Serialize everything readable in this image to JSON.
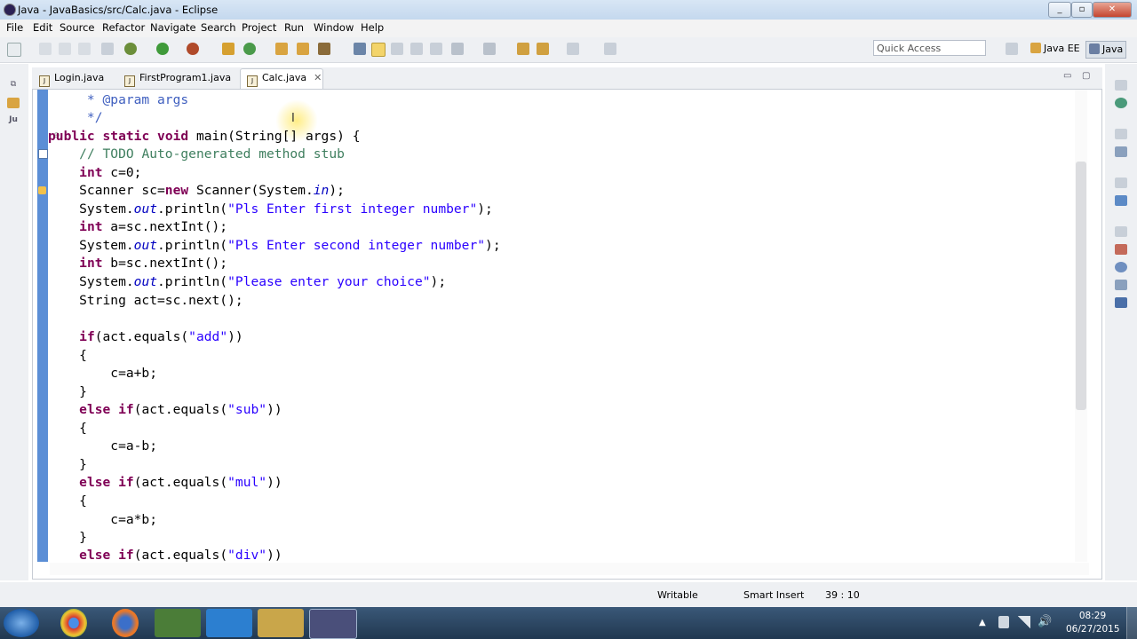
{
  "window": {
    "title": "Java - JavaBasics/src/Calc.java - Eclipse"
  },
  "menu": [
    "File",
    "Edit",
    "Source",
    "Refactor",
    "Navigate",
    "Search",
    "Project",
    "Run",
    "Window",
    "Help"
  ],
  "toolbar": {
    "quick_access_placeholder": "Quick Access",
    "perspective_javaee": "Java EE",
    "perspective_java": "Java"
  },
  "tabs": [
    {
      "label": "Login.java"
    },
    {
      "label": "FirstProgram1.java"
    },
    {
      "label": "Calc.java",
      "active": true
    }
  ],
  "code_lines": [
    "     * @param args",
    "     */",
    "public static void main(String[] args) {",
    "    // TODO Auto-generated method stub",
    "    int c=0;",
    "    Scanner sc=new Scanner(System.in);",
    "    System.out.println(\"Pls Enter first integer number\");",
    "    int a=sc.nextInt();",
    "    System.out.println(\"Pls Enter second integer number\");",
    "    int b=sc.nextInt();",
    "    System.out.println(\"Please enter your choice\");",
    "    String act=sc.next();",
    "",
    "    if(act.equals(\"add\"))",
    "    {",
    "        c=a+b;",
    "    }",
    "    else if(act.equals(\"sub\"))",
    "    {",
    "        c=a-b;",
    "    }",
    "    else if(act.equals(\"mul\"))",
    "    {",
    "        c=a*b;",
    "    }",
    "    else if(act.equals(\"div\"))"
  ],
  "status": {
    "writable": "Writable",
    "insert_mode": "Smart Insert",
    "position": "39 : 10"
  },
  "taskbar": {
    "time": "08:29",
    "date": "06/27/2015"
  }
}
